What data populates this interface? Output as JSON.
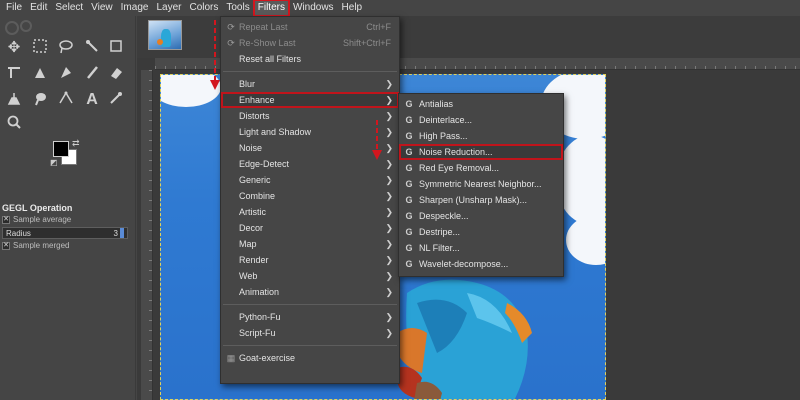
{
  "menubar": {
    "items": [
      "File",
      "Edit",
      "Select",
      "View",
      "Image",
      "Layer",
      "Colors",
      "Tools",
      "Filters",
      "Windows",
      "Help"
    ],
    "active": "Filters"
  },
  "tool_options": {
    "title": "GEGL Operation",
    "sample_average": "Sample average",
    "radius_label": "Radius",
    "radius_value": "3",
    "sample_merged": "Sample merged"
  },
  "filters_menu": {
    "repeat_last": "Repeat Last",
    "repeat_last_shortcut": "Ctrl+F",
    "reshow_last": "Re-Show Last",
    "reshow_last_shortcut": "Shift+Ctrl+F",
    "reset_all": "Reset all Filters",
    "submenus": [
      "Blur",
      "Enhance",
      "Distorts",
      "Light and Shadow",
      "Noise",
      "Edge-Detect",
      "Generic",
      "Combine",
      "Artistic",
      "Decor",
      "Map",
      "Render",
      "Web",
      "Animation"
    ],
    "highlighted": "Enhance",
    "script_submenus": [
      "Python-Fu",
      "Script-Fu"
    ],
    "goat_exercise": "Goat-exercise"
  },
  "enhance_menu": {
    "items": [
      "Antialias",
      "Deinterlace...",
      "High Pass...",
      "Noise Reduction...",
      "Red Eye Removal...",
      "Symmetric Nearest Neighbor...",
      "Sharpen (Unsharp Mask)...",
      "Despeckle...",
      "Destripe...",
      "NL Filter...",
      "Wavelet-decompose..."
    ],
    "highlighted": "Noise Reduction...",
    "icon_glyph": "G"
  },
  "colors": {
    "annotation_red": "#d2161e",
    "background": "#454545",
    "sky": "#2f7ad2"
  }
}
